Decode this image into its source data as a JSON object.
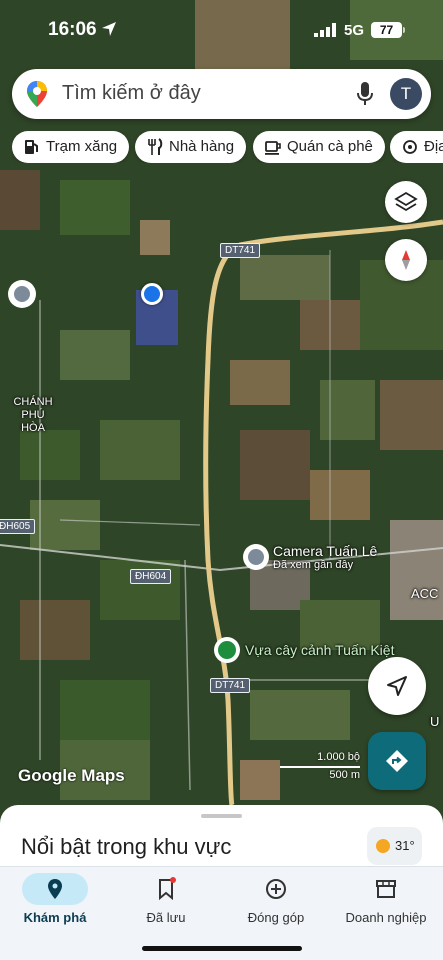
{
  "status_bar": {
    "time": "16:06",
    "network": "5G",
    "battery": "77"
  },
  "search": {
    "placeholder": "Tìm kiếm ở đây",
    "avatar_letter": "T"
  },
  "chips": [
    {
      "label": "Trạm xăng",
      "icon": "gas-station-icon"
    },
    {
      "label": "Nhà hàng",
      "icon": "restaurant-icon"
    },
    {
      "label": "Quán cà phê",
      "icon": "coffee-icon"
    },
    {
      "label": "Địa",
      "icon": "attraction-icon"
    }
  ],
  "map": {
    "roads": [
      "DT741",
      "DT741",
      "ĐH604",
      "ĐH605"
    ],
    "place": "CHÁNH PHÚ HÒA",
    "edge_labels": [
      "ACC",
      "U"
    ],
    "pois": [
      {
        "name": "Camera Tuấn Lê",
        "subtitle": "Đã xem gần đây",
        "icon": "recent-place-icon"
      },
      {
        "name": "Vựa cây cảnh Tuấn Kiệt",
        "subtitle": "",
        "icon": "flower-shop-icon"
      }
    ],
    "scale_ft": "1.000 bộ",
    "scale_m": "500 m",
    "brand": "Google Maps",
    "colors": {
      "road": "#e2c98a",
      "user_dot": "#1a73e8",
      "poi_green": "#1e8e3e"
    }
  },
  "sheet": {
    "title": "Nổi bật trong khu vực",
    "temperature": "31°"
  },
  "nav": [
    {
      "label": "Khám phá",
      "icon": "explore-pin-icon",
      "active": true
    },
    {
      "label": "Đã lưu",
      "icon": "bookmark-icon",
      "active": false
    },
    {
      "label": "Đóng góp",
      "icon": "add-circle-icon",
      "active": false
    },
    {
      "label": "Doanh nghiệp",
      "icon": "store-icon",
      "active": false
    }
  ]
}
